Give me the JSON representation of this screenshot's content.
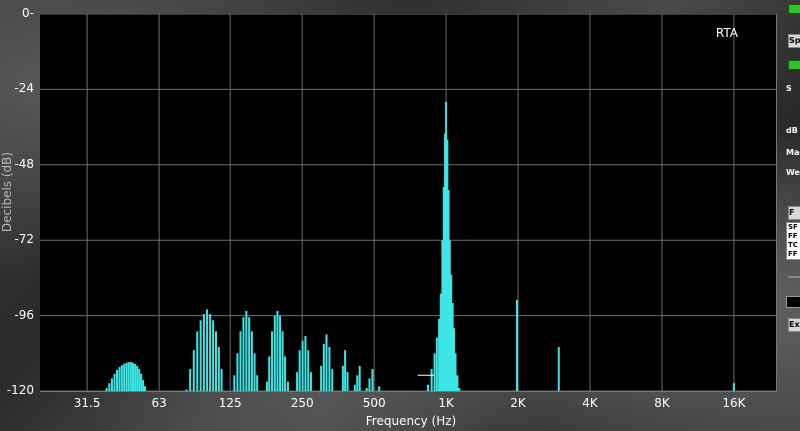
{
  "chart_data": {
    "type": "bar",
    "title": "RTA",
    "xlabel": "Frequency (Hz)",
    "ylabel": "Decibels (dB)",
    "x_scale": "log",
    "xlim": [
      20,
      24000
    ],
    "ylim": [
      -120,
      0
    ],
    "grid": true,
    "y_ticks": [
      "-120",
      "-96",
      "-72",
      "-48",
      "-24",
      "0-"
    ],
    "x_ticks": [
      {
        "label": "31.5",
        "hz": 31.5
      },
      {
        "label": "63",
        "hz": 63
      },
      {
        "label": "125",
        "hz": 125
      },
      {
        "label": "250",
        "hz": 250
      },
      {
        "label": "500",
        "hz": 500
      },
      {
        "label": "1K",
        "hz": 1000
      },
      {
        "label": "2K",
        "hz": 2000
      },
      {
        "label": "4K",
        "hz": 4000
      },
      {
        "label": "8K",
        "hz": 8000
      },
      {
        "label": "16K",
        "hz": 16000
      }
    ],
    "bar_color": "#3ee6e6",
    "series": [
      {
        "points": [
          [
            38,
            -119
          ],
          [
            39,
            -117.5
          ],
          [
            40,
            -116
          ],
          [
            41,
            -114.5
          ],
          [
            42,
            -113.3
          ],
          [
            43,
            -112.4
          ],
          [
            44,
            -111.8
          ],
          [
            45,
            -111.3
          ],
          [
            46,
            -111
          ],
          [
            47,
            -110.8
          ],
          [
            48,
            -110.8
          ],
          [
            49,
            -111
          ],
          [
            50,
            -111.4
          ],
          [
            51,
            -112
          ],
          [
            52,
            -113
          ],
          [
            53,
            -114.5
          ],
          [
            54,
            -116.5
          ],
          [
            55,
            -118.5
          ],
          [
            82,
            -119.5
          ],
          [
            85,
            -113
          ],
          [
            88,
            -107
          ],
          [
            91,
            -101
          ],
          [
            94,
            -97.5
          ],
          [
            97,
            -95.5
          ],
          [
            100,
            -94
          ],
          [
            103,
            -95.5
          ],
          [
            106,
            -97.5
          ],
          [
            109,
            -101
          ],
          [
            112,
            -106
          ],
          [
            115,
            -113
          ],
          [
            130,
            -115
          ],
          [
            134,
            -108
          ],
          [
            138,
            -101
          ],
          [
            142,
            -96.5
          ],
          [
            146,
            -94.5
          ],
          [
            150,
            -96.5
          ],
          [
            154,
            -101
          ],
          [
            158,
            -108
          ],
          [
            162,
            -115
          ],
          [
            178,
            -117
          ],
          [
            182,
            -109
          ],
          [
            187,
            -101
          ],
          [
            192,
            -96
          ],
          [
            197,
            -94.5
          ],
          [
            202,
            -96
          ],
          [
            207,
            -101
          ],
          [
            212,
            -109
          ],
          [
            218,
            -117
          ],
          [
            238,
            -114
          ],
          [
            244,
            -107
          ],
          [
            251,
            -104
          ],
          [
            258,
            -102.5
          ],
          [
            265,
            -107
          ],
          [
            272,
            -114
          ],
          [
            300,
            -112
          ],
          [
            308,
            -105
          ],
          [
            316,
            -102
          ],
          [
            325,
            -106
          ],
          [
            334,
            -113
          ],
          [
            370,
            -112
          ],
          [
            378,
            -107
          ],
          [
            387,
            -114
          ],
          [
            415,
            -118
          ],
          [
            425,
            -115
          ],
          [
            435,
            -112
          ],
          [
            465,
            -119
          ],
          [
            478,
            -116
          ],
          [
            492,
            -113
          ],
          [
            525,
            -118.5
          ],
          [
            840,
            -118
          ],
          [
            870,
            -113
          ],
          [
            895,
            -108
          ],
          [
            915,
            -103
          ],
          [
            935,
            -97
          ],
          [
            950,
            -89
          ],
          [
            965,
            -72
          ],
          [
            978,
            -55
          ],
          [
            990,
            -38
          ],
          [
            1000,
            -28
          ],
          [
            1012,
            -40
          ],
          [
            1024,
            -56
          ],
          [
            1036,
            -72
          ],
          [
            1050,
            -83
          ],
          [
            1065,
            -92
          ],
          [
            1080,
            -100
          ],
          [
            1095,
            -108
          ],
          [
            1115,
            -115
          ],
          [
            1135,
            -119
          ],
          [
            1980,
            -91
          ],
          [
            2960,
            -106
          ],
          [
            16000,
            -117.5
          ]
        ]
      }
    ],
    "annotation_line": {
      "from_hz": 760,
      "to_hz": 890,
      "db": -115
    }
  },
  "panel": {
    "btn_sp": "Sp",
    "label_s": "S",
    "label_db": "dB",
    "label_mag": "Mag",
    "label_we": "We",
    "btn_f": "F",
    "list_lines": [
      "SF",
      "FF",
      "TC",
      "FF"
    ],
    "btn_ex": "Ex",
    "led_color": "#2fc12f"
  }
}
